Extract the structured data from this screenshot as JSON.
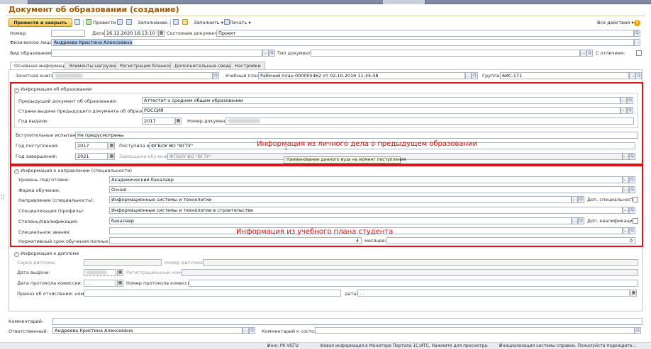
{
  "window": {
    "title": "Документ об образовании (создание)"
  },
  "toolbar": {
    "post_and_close": "Провести и закрыть",
    "post": "Провести",
    "fill_in": "Заполнение...",
    "fill": "Заполнить",
    "print": "Печать",
    "all_actions": "Все действия"
  },
  "header": {
    "number_label": "Номер:",
    "date_label": "Дата:",
    "date_value": "26.12.2020 16:13:10",
    "state_label": "Состояние документа:",
    "state_value": "Проект",
    "person_label": "Физическое лицо:",
    "person_value": "Андреева Кристина Алексеевна",
    "edu_type_label": "Вид образования:",
    "doc_type_label": "Тип документа:",
    "with_distinction_label": "С отличием:"
  },
  "tabs": [
    "Основная информация",
    "Элементы нагрузки",
    "Регистрация бланков",
    "Дополнительные сведения",
    "Настройки"
  ],
  "main": {
    "record_book_label": "Зачетная книга:",
    "study_plan_label": "Учебный план:",
    "study_plan_value": "Рабочий план 000005462 от 02.10.2019 11:35:38",
    "group_label": "Группа:",
    "group_value": "6ИС-171"
  },
  "edu_info": {
    "header": "Информация об образовании",
    "prev_doc_label": "Предыдущий документ об образовании:",
    "prev_doc_value": "Аттестат о среднем общем образовании",
    "country_label": "Страна выдачи предыдущего документа об образовании:",
    "country_value": "РОССИЯ",
    "issue_year_label": "Год выдачи:",
    "issue_year_value": "2017",
    "doc_number_label": "Номер документа:",
    "entrance_exams_label": "Вступительные испытания:",
    "entrance_exams_value": "Не предусмотрены",
    "admission_year_label": "Год поступления:",
    "admission_year_value": "2017",
    "admitted_to_label": "Поступила в:",
    "admitted_to_value": "ФГБОУ ВО \"ВГТУ\"",
    "graduation_year_label": "Год завершения:",
    "graduation_year_value": "2021",
    "finished_at_label": "Завершила обучение в:",
    "finished_at_value": "ФГБОУ ВО \"ВГТУ\"",
    "annotation": "Информация из личного дела о предыдущем образовании",
    "tooltip": "Наименование данного вуза на момент поступления"
  },
  "direction_info": {
    "header": "Информация о направлении (специальности)",
    "level_label": "Уровень подготовки:",
    "level_value": "Академический бакалавр",
    "form_label": "Форма обучения:",
    "form_value": "Очная",
    "direction_label": "Направление (специальность):",
    "direction_value": "Информационные системы и технологии",
    "extra_specialty_label": "Доп. специальность:",
    "specialization_label": "Специализация (профиль):",
    "specialization_value": "Информационные системы и технологии в строительстве",
    "degree_label": "Степень/Квалификация:",
    "degree_value": "бакалавр",
    "extra_qualification_label": "Доп. квалификация:",
    "special_title_label": "Специальное звание:",
    "duration_label": "Нормативный срок обучения полных лет:",
    "duration_years_value": "4",
    "months_label": "месяцев:",
    "duration_months_value": "0",
    "annotation": "Информация из учебного плана студента"
  },
  "diploma_info": {
    "header": "Информация о дипломе",
    "series_label": "Серия диплома:",
    "number_label": "Номер диплома:",
    "issue_date_label": "Дата выдачи:",
    "reg_number_label": "Регистрационный номер:",
    "commission_date_label": "Дата протокола комиссии:",
    "commission_date_value": " .  .",
    "commission_number_label": "Номер протокола комиссии:",
    "expulsion_order_label": "Приказ об отчислении: номер:",
    "date_label": "дата:",
    "date_value": " .  ."
  },
  "footer": {
    "comment_label": "Комментарий:",
    "responsible_label": "Ответственный:",
    "responsible_value": "Андреева Кристина Алексеевна",
    "state_comment_label": "Комментарий к состоянию:"
  },
  "statusbar": {
    "item1": "Инж: PK VGTU",
    "item2": "Новая информация в Мониторе Портала 1С:ИТС. Нажмите для просмотра.",
    "item3": "Инициализация системы справки. Пожалуйста подождите..."
  },
  "colors": {
    "accent_title": "#a55600",
    "annotation_red": "#e01212",
    "primary_button": "#f2c44c"
  }
}
